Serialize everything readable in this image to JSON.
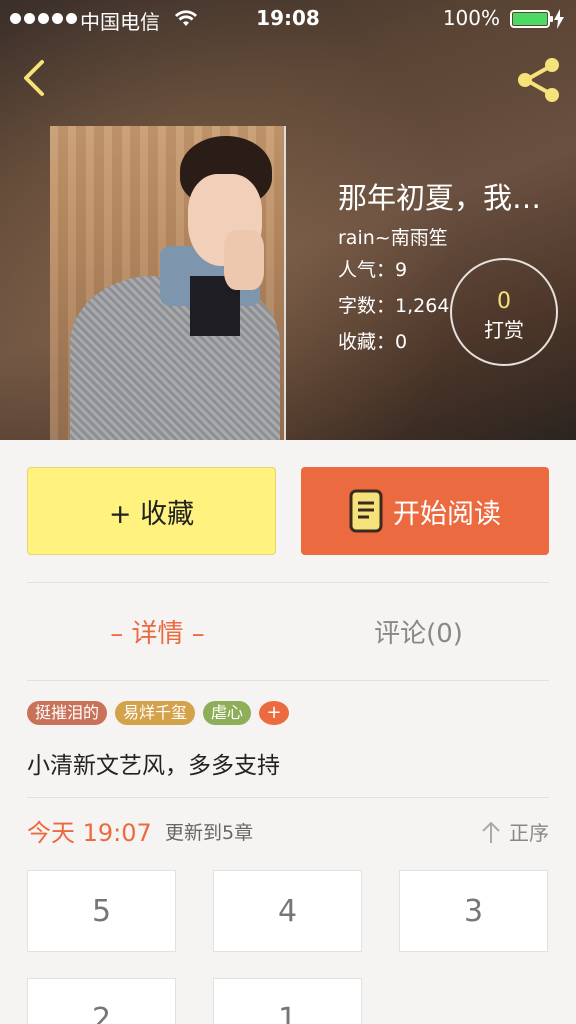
{
  "status_bar": {
    "carrier": "中国电信",
    "time": "19:08",
    "battery": "100%"
  },
  "book": {
    "title": "那年初夏，我…",
    "author": "rain~南雨笙",
    "stats": [
      {
        "key": "人气：",
        "value": "9"
      },
      {
        "key": "字数：",
        "value": "1,264"
      },
      {
        "key": "收藏：",
        "value": "0"
      }
    ],
    "tip": {
      "count": "0",
      "label": "打赏"
    }
  },
  "actions": {
    "favorite_label": "+ 收藏",
    "read_label": "开始阅读"
  },
  "tabs": {
    "detail": "– 详情 –",
    "comments": "评论(0)"
  },
  "tags": [
    {
      "label": "挺摧泪的",
      "color": "#c9725a"
    },
    {
      "label": "易烊千玺",
      "color": "#d4a24a"
    },
    {
      "label": "虐心",
      "color": "#8fae5a"
    },
    {
      "label": "+",
      "color": "#ec6a3f"
    }
  ],
  "intro": "小清新文艺风，多多支持",
  "update": {
    "date": "今天 19:07",
    "text": "更新到5章",
    "sort_label": "正序"
  },
  "chapters": [
    "5",
    "4",
    "3",
    "2",
    "1"
  ],
  "colors": {
    "accent": "#ec6a3f",
    "favorite_button": "#fff27e",
    "icon_yellow": "#f6e27a"
  }
}
